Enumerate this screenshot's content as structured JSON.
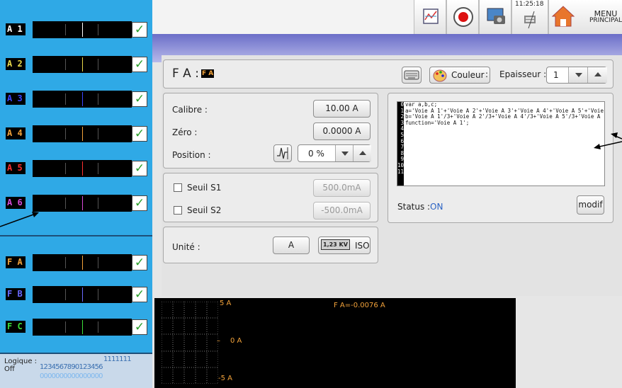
{
  "topbar": {
    "clock": "11:25:18",
    "menu_line1": "MENU",
    "menu_line2": "PRINCIPAL",
    "icons": [
      "chart-icon",
      "record-icon",
      "screenshot-icon",
      "network-icon",
      "home-icon"
    ]
  },
  "channels": [
    {
      "label": "A 1",
      "color": "#ffffff",
      "mark": "#ffffff"
    },
    {
      "label": "A 2",
      "color": "#e8d84a",
      "mark": "#e8d84a"
    },
    {
      "label": "A 3",
      "color": "#3a45ff",
      "mark": "#3a45ff"
    },
    {
      "label": "A 4",
      "color": "#f2a23a",
      "mark": "#f2a23a"
    },
    {
      "label": "A 5",
      "color": "#ff3030",
      "mark": "#ff3030"
    },
    {
      "label": "A 6",
      "color": "#d84ad8",
      "mark": "#d84ad8"
    }
  ],
  "functions": [
    {
      "label": "F A",
      "color": "#f2a23a",
      "mark": "#f2a23a"
    },
    {
      "label": "F B",
      "color": "#6a6aff",
      "mark": "#6a6aff"
    },
    {
      "label": "F C",
      "color": "#3adf3a",
      "mark": "#3adf3a"
    }
  ],
  "logic": {
    "label": "Logique :",
    "state": "Off",
    "tens": "1 1 1 1 1 1 1",
    "units": "1 2 3 4 5 6 7 8 9 0 1 2 3 4 5 6",
    "bits": "0 0 0 0 0 0 0 0 0 0 0 0 0 0 0 0"
  },
  "header": {
    "title": "F A :",
    "badge": "F A",
    "couleur": "Couleur",
    "epaisseur_label": "Epaisseur :",
    "epaisseur_value": "1"
  },
  "settings": {
    "calibre_label": "Calibre :",
    "calibre_value": "10.00 A",
    "zero_label": "Zéro :",
    "zero_value": "0.0000 A",
    "position_label": "Position :",
    "position_value": "0 %"
  },
  "thresholds": {
    "s1_label": "Seuil S1",
    "s1_value": "500.0mA",
    "s2_label": "Seuil S2",
    "s2_value": "-500.0mA"
  },
  "unit": {
    "label": "Unité :",
    "value": "A",
    "kv": "1,23 KV",
    "iso": "ISO"
  },
  "script": {
    "lines": [
      "0",
      "1",
      "2",
      "3",
      "4",
      "5",
      "6",
      "7",
      "8",
      "9",
      "10",
      "11"
    ],
    "code": "var a,b,c;\na='Voie A 1'+'Voie A 2'+'Voie A 3'+'Voie A 4'+'Voie A 5'+'Voie ...\nb='Voie A 1'/3+'Voie A 2'/3+'Voie A 4'/3+'Voie A 5'/3+'Voie A  ...\nfunction='Voie A 1';",
    "status_label": "Status :",
    "status_value": "ON",
    "modif": "modif"
  },
  "scope": {
    "top": "5 A",
    "mid": "0 A",
    "bottom": "-5 A",
    "readout": "F A=-0.0076 A"
  }
}
